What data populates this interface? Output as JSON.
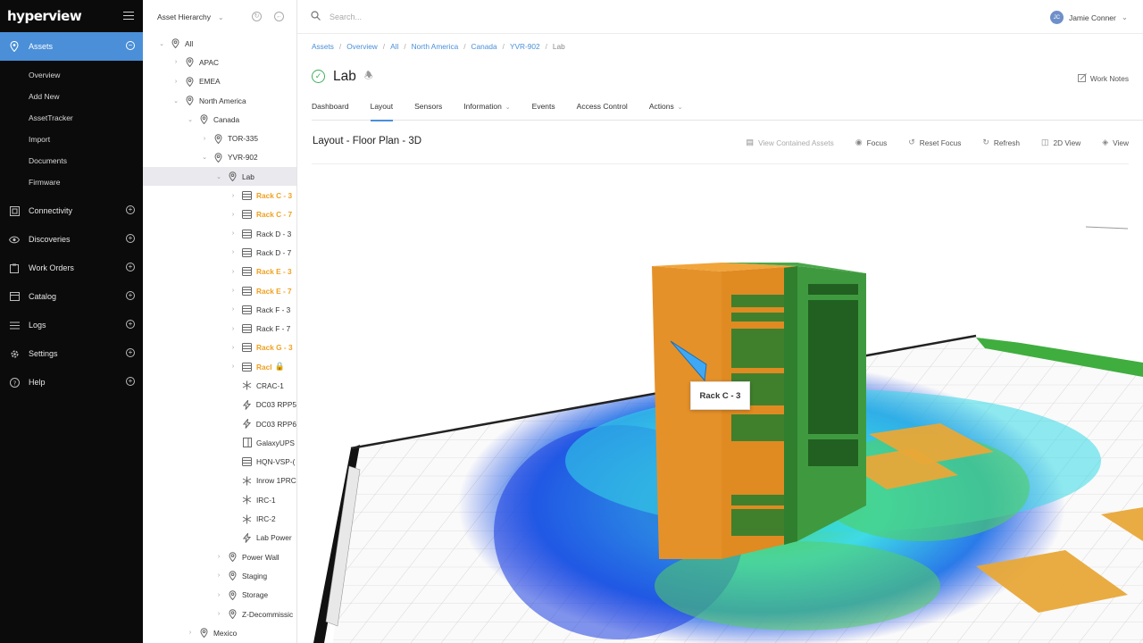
{
  "brand": "hyperview",
  "nav": {
    "sections": [
      {
        "label": "Assets",
        "icon": "location-pin-icon",
        "active": true,
        "subs": [
          "Overview",
          "Add New",
          "AssetTracker",
          "Import",
          "Documents",
          "Firmware"
        ]
      },
      {
        "label": "Connectivity",
        "icon": "connectivity-icon"
      },
      {
        "label": "Discoveries",
        "icon": "eye-icon"
      },
      {
        "label": "Work Orders",
        "icon": "clipboard-icon"
      },
      {
        "label": "Catalog",
        "icon": "catalog-icon"
      },
      {
        "label": "Logs",
        "icon": "list-icon"
      },
      {
        "label": "Settings",
        "icon": "gear-icon"
      },
      {
        "label": "Help",
        "icon": "help-icon"
      }
    ]
  },
  "tree": {
    "header": "Asset Hierarchy",
    "rows": [
      {
        "label": "All",
        "depth": 0,
        "icon": "pin",
        "exp": "v"
      },
      {
        "label": "APAC",
        "depth": 1,
        "icon": "pin",
        "exp": ">"
      },
      {
        "label": "EMEA",
        "depth": 1,
        "icon": "pin",
        "exp": ">"
      },
      {
        "label": "North America",
        "depth": 1,
        "icon": "pin",
        "exp": "v"
      },
      {
        "label": "Canada",
        "depth": 2,
        "icon": "pin",
        "exp": "v"
      },
      {
        "label": "TOR-335",
        "depth": 3,
        "icon": "pin",
        "exp": ">"
      },
      {
        "label": "YVR-902",
        "depth": 3,
        "icon": "pin",
        "exp": "v"
      },
      {
        "label": "Lab",
        "depth": 4,
        "icon": "pin",
        "exp": "v",
        "selected": true
      },
      {
        "label": "Rack C - 3",
        "depth": 5,
        "icon": "rack",
        "exp": ">",
        "warn": true
      },
      {
        "label": "Rack C - 7",
        "depth": 5,
        "icon": "rack",
        "exp": ">",
        "warn": true
      },
      {
        "label": "Rack D - 3",
        "depth": 5,
        "icon": "rack",
        "exp": ">"
      },
      {
        "label": "Rack D - 7",
        "depth": 5,
        "icon": "rack",
        "exp": ">"
      },
      {
        "label": "Rack E - 3",
        "depth": 5,
        "icon": "rack",
        "exp": ">",
        "warn": true
      },
      {
        "label": "Rack E - 7",
        "depth": 5,
        "icon": "rack",
        "exp": ">",
        "warn": true
      },
      {
        "label": "Rack F - 3",
        "depth": 5,
        "icon": "rack",
        "exp": ">"
      },
      {
        "label": "Rack F - 7",
        "depth": 5,
        "icon": "rack",
        "exp": ">"
      },
      {
        "label": "Rack G - 3",
        "depth": 5,
        "icon": "rack",
        "exp": ">",
        "warn": true
      },
      {
        "label": "Racl",
        "depth": 5,
        "icon": "rack",
        "exp": ">",
        "warn": true,
        "lock": true
      },
      {
        "label": "CRAC-1",
        "depth": 5,
        "icon": "snow"
      },
      {
        "label": "DC03 RPP5",
        "depth": 5,
        "icon": "bolt"
      },
      {
        "label": "DC03 RPP6",
        "depth": 5,
        "icon": "bolt"
      },
      {
        "label": "GalaxyUPS",
        "depth": 5,
        "icon": "box"
      },
      {
        "label": "HQN-VSP-(",
        "depth": 5,
        "icon": "rack"
      },
      {
        "label": "Inrow 1PRC",
        "depth": 5,
        "icon": "snow"
      },
      {
        "label": "IRC-1",
        "depth": 5,
        "icon": "snow"
      },
      {
        "label": "IRC-2",
        "depth": 5,
        "icon": "snow"
      },
      {
        "label": "Lab Power",
        "depth": 5,
        "icon": "bolt"
      },
      {
        "label": "Power Wall",
        "depth": 4,
        "icon": "pin",
        "exp": ">"
      },
      {
        "label": "Staging",
        "depth": 4,
        "icon": "pin",
        "exp": ">"
      },
      {
        "label": "Storage",
        "depth": 4,
        "icon": "pin",
        "exp": ">"
      },
      {
        "label": "Z-Decommissic",
        "depth": 4,
        "icon": "pin",
        "exp": ">"
      },
      {
        "label": "Mexico",
        "depth": 2,
        "icon": "pin",
        "exp": ">"
      }
    ]
  },
  "search": {
    "placeholder": "Search..."
  },
  "user": {
    "initials": "JC",
    "name": "Jamie Conner"
  },
  "breadcrumbs": [
    "Assets",
    "Overview",
    "All",
    "North America",
    "Canada",
    "YVR-902",
    "Lab"
  ],
  "page": {
    "title": "Lab",
    "work_notes": "Work Notes"
  },
  "tabs": [
    {
      "label": "Dashboard"
    },
    {
      "label": "Layout",
      "active": true
    },
    {
      "label": "Sensors"
    },
    {
      "label": "Information",
      "dropdown": true
    },
    {
      "label": "Events"
    },
    {
      "label": "Access Control"
    },
    {
      "label": "Actions",
      "dropdown": true
    }
  ],
  "section_title": "Layout - Floor Plan - 3D",
  "toolbar": [
    {
      "label": "View Contained Assets",
      "icon": "rack-icon",
      "disabled": true
    },
    {
      "label": "Focus",
      "icon": "eye-icon"
    },
    {
      "label": "Reset Focus",
      "icon": "reset-icon"
    },
    {
      "label": "Refresh",
      "icon": "refresh-icon"
    },
    {
      "label": "2D View",
      "icon": "2d-view-icon"
    },
    {
      "label": "View",
      "icon": "layers-icon"
    }
  ],
  "scene": {
    "tooltip": "Rack C - 3"
  },
  "colors": {
    "accent": "#4a8fd8",
    "warning": "#f0a020",
    "ok": "#3fae5b",
    "rack_orange": "#e8962e",
    "rack_green": "#3f9a3f"
  }
}
